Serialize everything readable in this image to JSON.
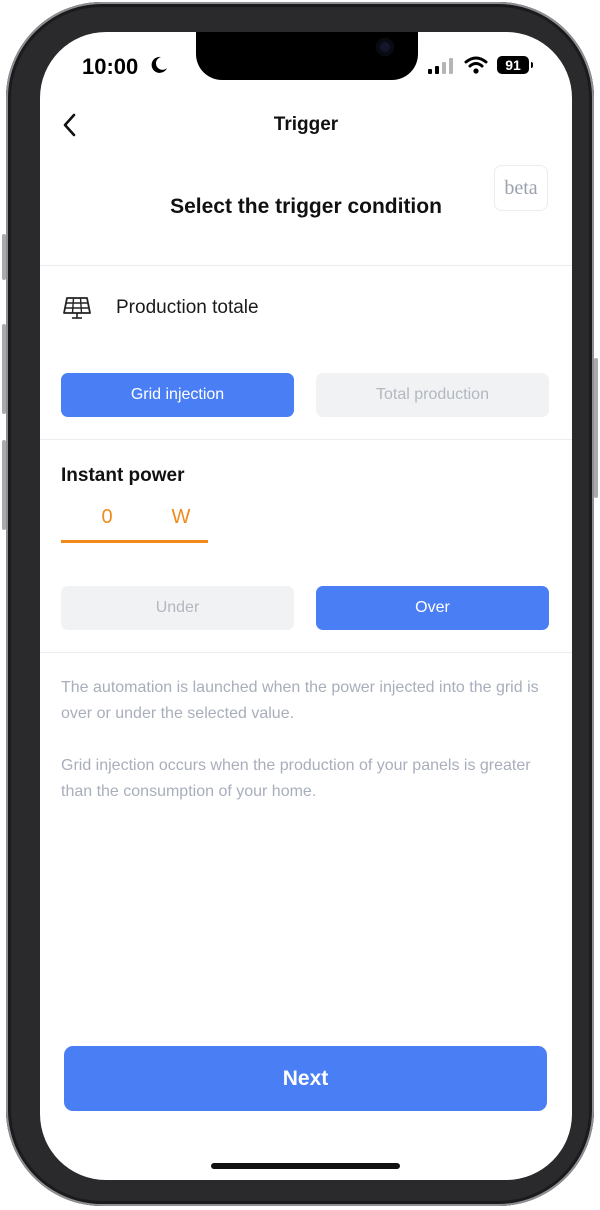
{
  "status_bar": {
    "time": "10:00",
    "battery": "91"
  },
  "nav": {
    "title": "Trigger",
    "back_icon": "chevron-left-icon"
  },
  "header": {
    "heading": "Select the trigger condition",
    "badge": "beta"
  },
  "device": {
    "icon": "solar-panel-icon",
    "name": "Production totale"
  },
  "source_toggle": {
    "options": [
      "Grid injection",
      "Total production"
    ],
    "selected": "Grid injection"
  },
  "power": {
    "label": "Instant power",
    "value": "0",
    "unit": "W"
  },
  "comparison_toggle": {
    "options": [
      "Under",
      "Over"
    ],
    "selected": "Over"
  },
  "description": {
    "line1": "The automation is launched when the power injected into the grid is over or under the selected value.",
    "line2": "Grid injection occurs when the production of your panels is greater than the consumption of your home."
  },
  "footer": {
    "next_label": "Next"
  },
  "colors": {
    "accent": "#4a7ef5",
    "power": "#f08a1c",
    "muted_text": "#a8aebb"
  }
}
